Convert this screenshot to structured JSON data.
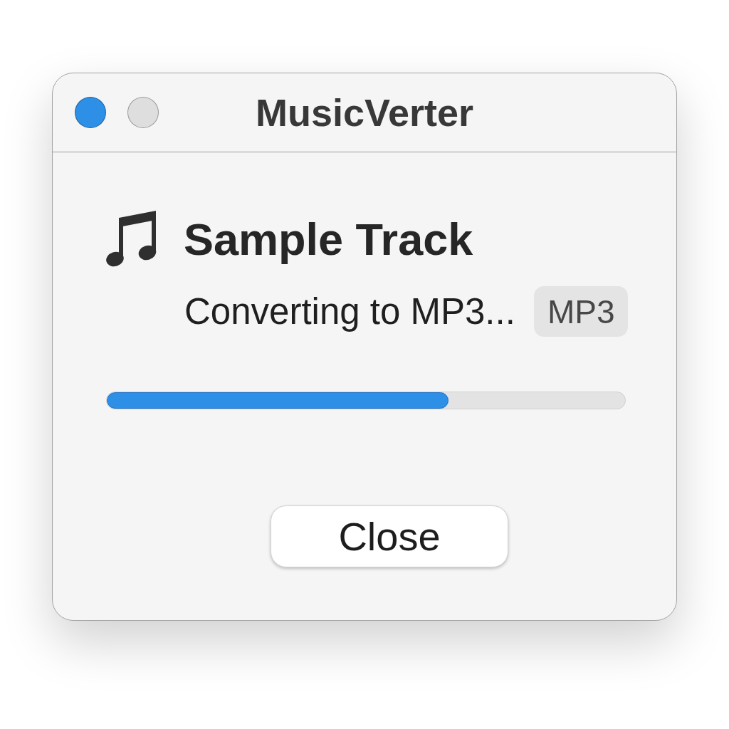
{
  "window": {
    "title": "MusicVerter",
    "controls": [
      {
        "color": "#2e8fe6"
      },
      {
        "color": "#dedede"
      }
    ]
  },
  "track": {
    "title": "Sample Track",
    "status": "Converting to MP3...",
    "badge": "MP3"
  },
  "progress": {
    "level": 0.66
  },
  "buttons": [
    {
      "label": "Close"
    }
  ]
}
